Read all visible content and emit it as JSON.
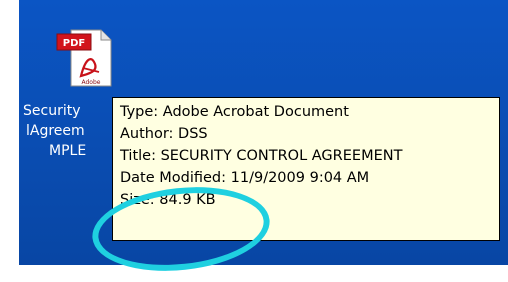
{
  "desktop": {
    "background_color": "#0a4fb3",
    "file_icon": {
      "name": "pdf-file-icon",
      "badge_text": "PDF",
      "sub_text": "Adobe"
    },
    "file_label_lines": [
      "Security",
      "lAgreem",
      "MPLE"
    ]
  },
  "tooltip": {
    "background_color": "#ffffe1",
    "lines": [
      "Type: Adobe Acrobat Document",
      "Author: DSS",
      "Title: SECURITY CONTROL AGREEMENT",
      "Date Modified: 11/9/2009 9:04 AM",
      "Size: 84.9 KB"
    ]
  },
  "annotation": {
    "shape": "ellipse",
    "color": "#1fd0e0"
  }
}
